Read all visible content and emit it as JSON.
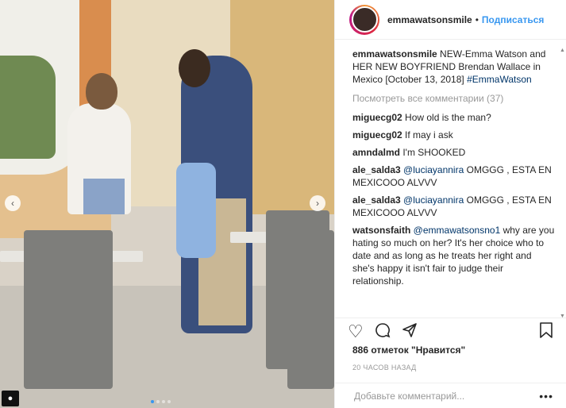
{
  "post": {
    "username": "emmawatsonsmile",
    "follow_label": "Подписаться",
    "dot": "•"
  },
  "caption": {
    "username": "emmawatsonsmile",
    "text": " NEW-Emma Watson and HER NEW BOYFRIEND Brendan Wallace in Mexico [October 13, 2018]",
    "hashtag": "#EmmaWatson"
  },
  "view_all": "Посмотреть все комментарии (37)",
  "comments": [
    {
      "user": "miguecg02",
      "mention": "",
      "text": " How old is the man?"
    },
    {
      "user": "miguecg02",
      "mention": "",
      "text": " If may i ask"
    },
    {
      "user": "amndalmd",
      "mention": "",
      "text": " I'm SHOOKED"
    },
    {
      "user": "ale_salda3",
      "mention": " @luciayannira",
      "text": " OMGGG , ESTA EN MEXICOOO ALVVV"
    },
    {
      "user": "ale_salda3",
      "mention": " @luciayannira",
      "text": " OMGGG , ESTA EN MEXICOOO ALVVV"
    },
    {
      "user": "watsonsfaith",
      "mention": " @emmawatsonsno1",
      "text": " why are you hating so much on her? It's her choice who to date and as long as he treats her right and she's happy it isn't fair to judge their relationship."
    }
  ],
  "likes": "886 отметок \"Нравится\"",
  "time": "20 ЧАСОВ НАЗАД",
  "add_comment_placeholder": "Добавьте комментарий...",
  "more": "•••",
  "icons": {
    "like": "heart-icon",
    "comment": "comment-icon",
    "share": "share-icon",
    "save": "bookmark-icon"
  },
  "colors": {
    "link": "#3897f0",
    "mention": "#003569",
    "muted": "#999999"
  }
}
